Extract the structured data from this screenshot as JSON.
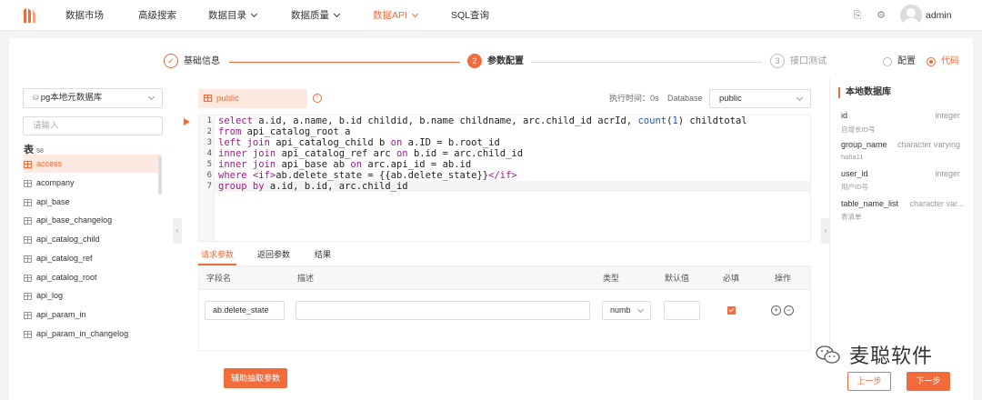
{
  "nav": {
    "items": [
      "数据市场",
      "高级搜索",
      "数据目录",
      "数据质量",
      "数据API",
      "SQL查询"
    ],
    "user": "admin"
  },
  "steps": {
    "s1": {
      "num": "✓",
      "label": "基础信息"
    },
    "s2": {
      "num": "2",
      "label": "参数配置"
    },
    "s3": {
      "num": "3",
      "label": "接口测试"
    }
  },
  "mode": {
    "config": "配置",
    "code": "代码",
    "selected": "代码"
  },
  "left": {
    "datasource": "pg本地元数据库",
    "search_placeholder": "请输入",
    "tables_title": "表",
    "tables_count": "58",
    "tables": [
      "access",
      "acompany",
      "api_base",
      "api_base_changelog",
      "api_catalog_child",
      "api_catalog_ref",
      "api_catalog_root",
      "api_log",
      "api_param_in",
      "api_param_in_changelog"
    ],
    "active_table": "access"
  },
  "editor": {
    "schema_tab": "public",
    "exec_time": "执行时间：0s",
    "db_label": "Database",
    "db_value": "public",
    "lines": [
      "1",
      "2",
      "3",
      "4",
      "5",
      "6",
      "7"
    ]
  },
  "param_tabs": {
    "request": "请求参数",
    "response": "返回参数",
    "result": "结果"
  },
  "param_table": {
    "headers": {
      "field": "字段名",
      "desc": "描述",
      "type": "类型",
      "default": "默认值",
      "required": "必填",
      "ops": "操作"
    },
    "row": {
      "field": "ab.delete_state",
      "desc": "",
      "type": "numb",
      "default": "",
      "required": true
    }
  },
  "buttons": {
    "extract": "辅助抽取参数",
    "prev": "上一步",
    "next": "下一步"
  },
  "right": {
    "title": "本地数据库",
    "fields": [
      {
        "name": "id",
        "type": "integer",
        "desc": "自增长ID号"
      },
      {
        "name": "group_name",
        "type": "character varying",
        "desc": "haha11"
      },
      {
        "name": "user_id",
        "type": "integer",
        "desc": "用户ID号"
      },
      {
        "name": "table_name_list",
        "type": "character var...",
        "desc": "表清单"
      }
    ]
  },
  "watermark": "麦聪软件",
  "colors": {
    "accent": "#f26b3a",
    "keyword": "#a2198b",
    "function": "#1a56c4"
  }
}
